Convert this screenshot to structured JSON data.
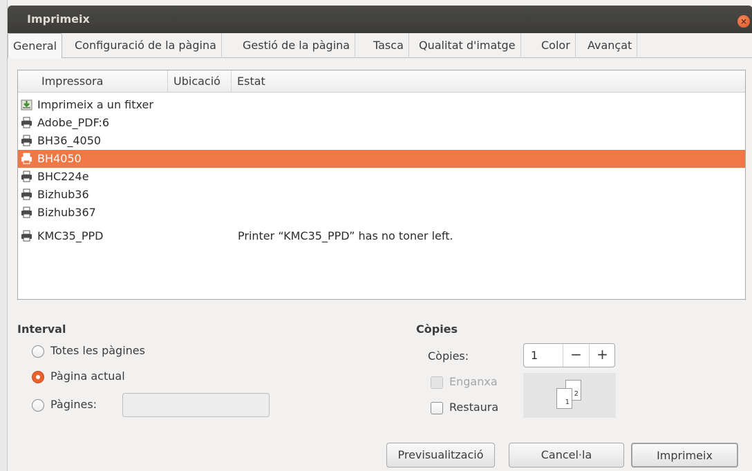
{
  "window": {
    "title": "Imprimeix"
  },
  "tabs": [
    {
      "label": "General"
    },
    {
      "label": "Configuració de la pàgina"
    },
    {
      "label": "Gestió de la pàgina"
    },
    {
      "label": "Tasca"
    },
    {
      "label": "Qualitat d'imatge"
    },
    {
      "label": "Color"
    },
    {
      "label": "Avançat"
    }
  ],
  "printer_list": {
    "columns": [
      "Impressora",
      "Ubicació",
      "Estat"
    ],
    "rows": [
      {
        "name": "Imprimeix a un fitxer",
        "location": "",
        "status": "",
        "icon": "print-to-file-icon"
      },
      {
        "name": "Adobe_PDF:6",
        "location": "",
        "status": "",
        "icon": "printer-icon"
      },
      {
        "name": "BH36_4050",
        "location": "",
        "status": "",
        "icon": "printer-icon"
      },
      {
        "name": "BH4050",
        "location": "",
        "status": "",
        "icon": "printer-icon",
        "selected": true
      },
      {
        "name": "BHC224e",
        "location": "",
        "status": "",
        "icon": "printer-icon"
      },
      {
        "name": "Bizhub36",
        "location": "",
        "status": "",
        "icon": "printer-icon"
      },
      {
        "name": "Bizhub367",
        "location": "",
        "status": "",
        "icon": "printer-icon"
      },
      {
        "name": "KMC35_PPD",
        "location": "",
        "status": "Printer “KMC35_PPD” has no toner left.",
        "icon": "printer-icon"
      }
    ]
  },
  "interval": {
    "title": "Interval",
    "all_pages": "Totes les pàgines",
    "current_page": "Pàgina actual",
    "pages": "Pàgines:",
    "pages_value": "",
    "selected": "current_page"
  },
  "copies": {
    "title": "Còpies",
    "label": "Còpies:",
    "value": "1",
    "minus": "−",
    "plus": "+",
    "collate": "Enganxa",
    "reverse": "Restaura",
    "preview_page_1": "1",
    "preview_page_2": "2"
  },
  "buttons": {
    "preview": "Previsualització",
    "cancel": "Cancel·la",
    "print": "Imprimeix"
  },
  "colors": {
    "accent": "#f07746",
    "titlebar": "#3c3b37",
    "close": "#e0521f"
  }
}
